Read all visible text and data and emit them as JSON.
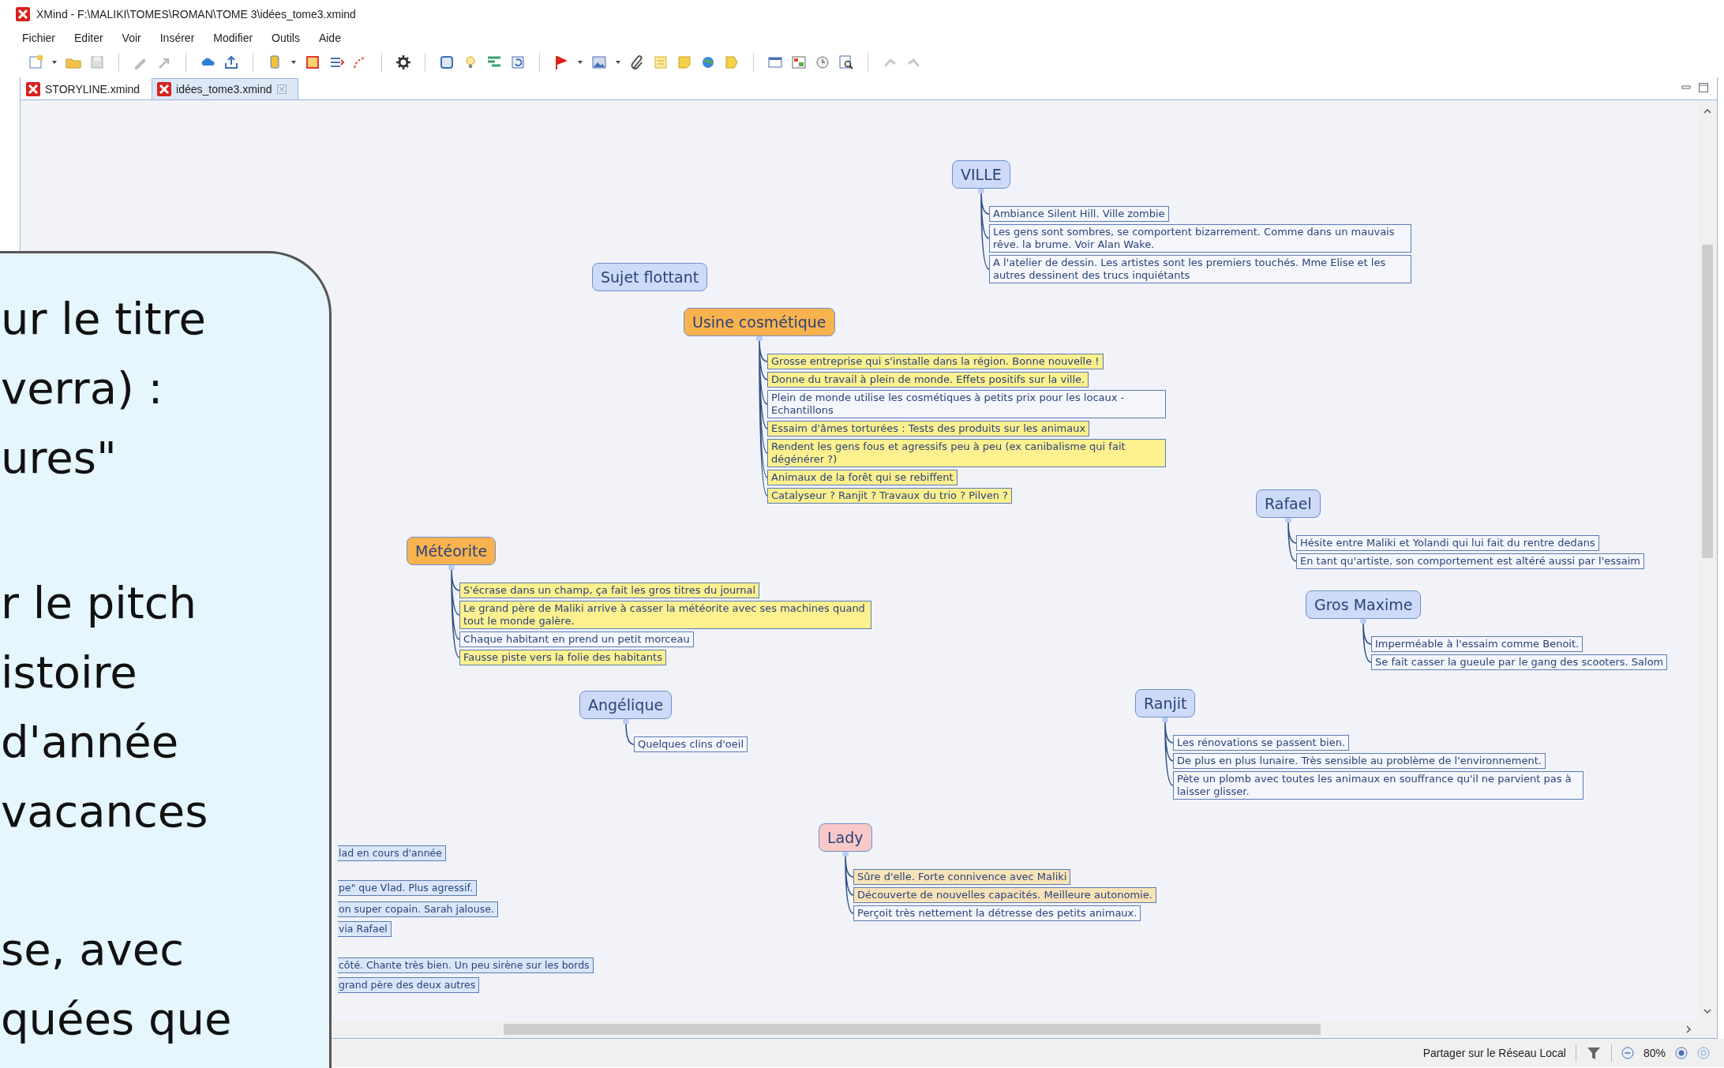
{
  "window": {
    "title": "XMind - F:\\MALIKI\\TOMES\\ROMAN\\TOME 3\\idées_tome3.xmind"
  },
  "menu": [
    "Fichier",
    "Editer",
    "Voir",
    "Insérer",
    "Modifier",
    "Outils",
    "Aide"
  ],
  "tabs": [
    {
      "label": "STORYLINE.xmind",
      "selected": false
    },
    {
      "label": "idées_tome3.xmind",
      "selected": true
    }
  ],
  "map": {
    "topics": [
      {
        "label": "Sujet flottant",
        "color": "#cddbf8"
      },
      {
        "label": "VILLE",
        "color": "#cddbf8",
        "notes": [
          {
            "text": "Ambiance Silent Hill. Ville zombie",
            "color": "#f4f6fc"
          },
          {
            "text": "Les gens sont sombres, se comportent bizarrement. Comme dans un mauvais rêve. la brume. Voir Alan Wake.",
            "color": "#f4f6fc"
          },
          {
            "text": "A l'atelier de dessin. Les artistes sont les premiers touchés. Mme Elise et les autres dessinent des trucs inquiétants",
            "color": "#f4f6fc"
          }
        ]
      },
      {
        "label": "Usine cosmétique",
        "color": "#f8b24e",
        "notes": [
          {
            "text": "Grosse entreprise qui s'installe dans la région. Bonne nouvelle !",
            "color": "#fdf08e"
          },
          {
            "text": "Donne du travail à plein de monde. Effets positifs sur la ville.",
            "color": "#fdf08e"
          },
          {
            "text": "Plein de monde utilise les cosmétiques à petits prix pour les locaux - Echantillons",
            "color": "#f4f6fc"
          },
          {
            "text": "Essaim d'âmes torturées : Tests des produits sur les animaux",
            "color": "#fdf08e"
          },
          {
            "text": "Rendent les gens fous et agressifs peu à peu (ex canibalisme qui fait dégénérer ?)",
            "color": "#fdf08e"
          },
          {
            "text": "Animaux de la forêt qui se rebiffent",
            "color": "#fdf08e"
          },
          {
            "text": "Catalyseur ? Ranjit ? Travaux du trio ? Pilven ?",
            "color": "#fdf08e"
          }
        ]
      },
      {
        "label": "Rafael",
        "color": "#cddbf8",
        "notes": [
          {
            "text": "Hésite entre Maliki et Yolandi qui lui fait du rentre dedans",
            "color": "#f4f6fc"
          },
          {
            "text": "En tant qu'artiste, son comportement est altéré aussi par l'essaim",
            "color": "#f4f6fc"
          }
        ]
      },
      {
        "label": "Météorite",
        "color": "#f8b24e",
        "notes": [
          {
            "text": "S'écrase dans un champ, ça fait les gros titres du journal",
            "color": "#fdf08e"
          },
          {
            "text": "Le grand père de Maliki arrive à casser la météorite avec ses machines quand tout le monde galère.",
            "color": "#fdf08e"
          },
          {
            "text": "Chaque habitant en prend un petit morceau",
            "color": "#f4f6fc"
          },
          {
            "text": "Fausse piste vers la folie des habitants",
            "color": "#fdf08e"
          }
        ]
      },
      {
        "label": "Gros Maxime",
        "color": "#cddbf8",
        "notes": [
          {
            "text": "Imperméable à l'essaim comme Benoit.",
            "color": "#f4f6fc"
          },
          {
            "text": "Se fait casser la gueule par le gang des scooters. Salom",
            "color": "#f4f6fc"
          }
        ]
      },
      {
        "label": "Angélique",
        "color": "#cddbf8",
        "notes": [
          {
            "text": "Quelques clins d'oeil",
            "color": "#f4f6fc"
          }
        ]
      },
      {
        "label": "Ranjit",
        "color": "#cddbf8",
        "notes": [
          {
            "text": "Les rénovations se passent bien.",
            "color": "#f4f6fc"
          },
          {
            "text": "De plus en plus lunaire. Très sensible au problème de l'environnement.",
            "color": "#f4f6fc"
          },
          {
            "text": "Pète un plomb avec toutes les animaux en souffrance qu'il ne parvient pas à laisser glisser.",
            "color": "#f4f6fc"
          }
        ]
      },
      {
        "label": "Lady",
        "color": "#f9c9c9",
        "notes": [
          {
            "text": "Sûre d'elle. Forte connivence avec Maliki",
            "color": "#f8e2b8"
          },
          {
            "text": "Découverte de nouvelles capacités. Meilleure autonomie.",
            "color": "#f8e2b8"
          },
          {
            "text": "Perçoit très nettement la détresse des petits animaux.",
            "color": "#f4f6fc"
          }
        ]
      }
    ],
    "partial_notes": [
      {
        "text": "lad en cours d'année",
        "color": "#d9e6fa"
      },
      {
        "text": "pe\" que Vlad. Plus agressif.",
        "color": "#d9e6fa"
      },
      {
        "text": "on super copain. Sarah jalouse.",
        "color": "#d9e6fa"
      },
      {
        "text": "via Rafael",
        "color": "#d9e6fa"
      },
      {
        "text": "côté. Chante très bien. Un peu sirène sur les bords",
        "color": "#d9e6fa"
      },
      {
        "text": "grand père des deux autres",
        "color": "#d9e6fa"
      }
    ]
  },
  "bubble": {
    "paragraphs": [
      [
        "ur le titre",
        "verra) :",
        "ures\""
      ],
      [
        "r le pitch",
        "istoire",
        "d'année",
        "vacances"
      ],
      [
        "se, avec",
        "quées que"
      ]
    ]
  },
  "status_bar": {
    "share": "Partager sur le Réseau Local",
    "zoom": "80%"
  }
}
